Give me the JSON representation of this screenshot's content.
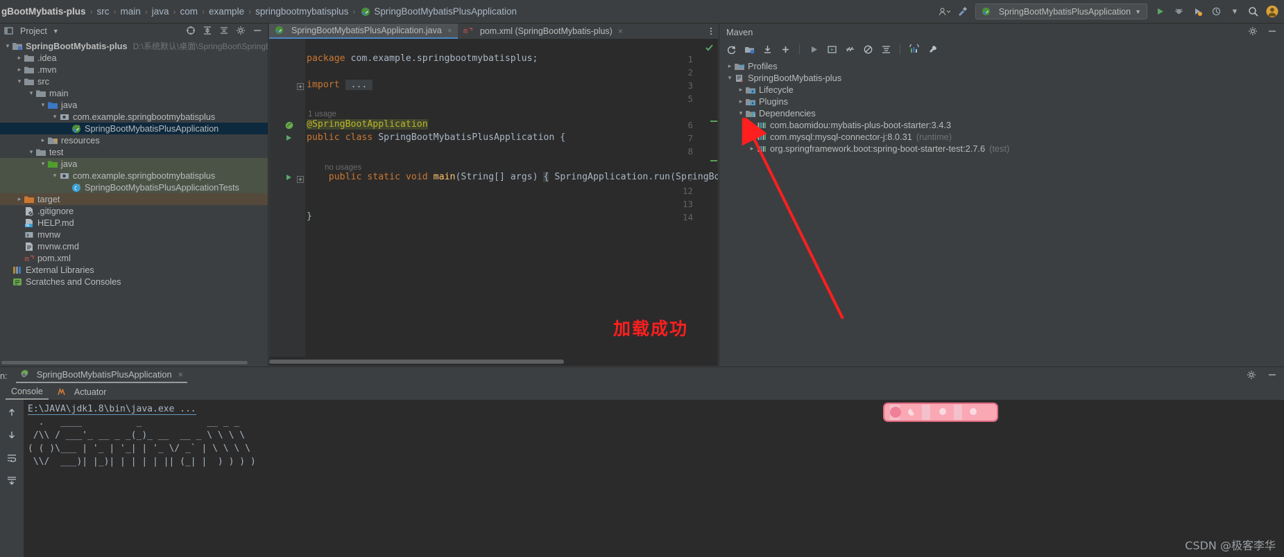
{
  "titlebar": {
    "breadcrumb": [
      "gBootMybatis-plus",
      "src",
      "main",
      "java",
      "com",
      "example",
      "springbootmybatisplus",
      "SpringBootMybatisPlusApplication"
    ],
    "breadcrumb_separator": "›",
    "run_config": "SpringBootMybatisPlusApplication",
    "icons": [
      "user-avatar-icon",
      "hammer-build-icon",
      "run-icon",
      "debug-icon",
      "coverage-icon",
      "profiler-icon",
      "more-icon",
      "search-icon",
      "settings-avatar-icon"
    ]
  },
  "project_panel": {
    "title": "Project",
    "header_icons": [
      "select-opened-file-icon",
      "expand-all-icon",
      "collapse-all-icon",
      "settings-icon",
      "hide-icon"
    ],
    "tree": [
      {
        "label": "SpringBootMybatis-plus",
        "hint": "D:\\系统默认\\桌面\\SpringBoot\\SpringBootMybatis",
        "depth": 0,
        "arrow": "open",
        "icon": "project-root-icon",
        "bold": true,
        "state": "normal"
      },
      {
        "label": ".idea",
        "hint": "",
        "depth": 1,
        "arrow": "closed",
        "icon": "folder-icon",
        "bold": false,
        "state": "normal"
      },
      {
        "label": ".mvn",
        "hint": "",
        "depth": 1,
        "arrow": "closed",
        "icon": "folder-icon",
        "bold": false,
        "state": "normal"
      },
      {
        "label": "src",
        "hint": "",
        "depth": 1,
        "arrow": "open",
        "icon": "folder-icon",
        "bold": false,
        "state": "normal"
      },
      {
        "label": "main",
        "hint": "",
        "depth": 2,
        "arrow": "open",
        "icon": "folder-icon",
        "bold": false,
        "state": "normal"
      },
      {
        "label": "java",
        "hint": "",
        "depth": 3,
        "arrow": "open",
        "icon": "source-root-icon",
        "bold": false,
        "state": "normal"
      },
      {
        "label": "com.example.springbootmybatisplus",
        "hint": "",
        "depth": 4,
        "arrow": "open",
        "icon": "package-icon",
        "bold": false,
        "state": "normal"
      },
      {
        "label": "SpringBootMybatisPlusApplication",
        "hint": "",
        "depth": 5,
        "arrow": "none",
        "icon": "spring-class-icon",
        "bold": false,
        "state": "selected"
      },
      {
        "label": "resources",
        "hint": "",
        "depth": 3,
        "arrow": "closed",
        "icon": "resource-root-icon",
        "bold": false,
        "state": "normal"
      },
      {
        "label": "test",
        "hint": "",
        "depth": 2,
        "arrow": "open",
        "icon": "folder-icon",
        "bold": false,
        "state": "normal"
      },
      {
        "label": "java",
        "hint": "",
        "depth": 3,
        "arrow": "open",
        "icon": "test-source-root-icon",
        "bold": false,
        "state": "green"
      },
      {
        "label": "com.example.springbootmybatisplus",
        "hint": "",
        "depth": 4,
        "arrow": "open",
        "icon": "package-icon",
        "bold": false,
        "state": "green"
      },
      {
        "label": "SpringBootMybatisPlusApplicationTests",
        "hint": "",
        "depth": 5,
        "arrow": "none",
        "icon": "test-class-icon",
        "bold": false,
        "state": "green"
      },
      {
        "label": "target",
        "hint": "",
        "depth": 1,
        "arrow": "closed",
        "icon": "excluded-folder-icon",
        "bold": false,
        "state": "brown"
      },
      {
        "label": ".gitignore",
        "hint": "",
        "depth": 1,
        "arrow": "none",
        "icon": "gitignore-file-icon",
        "bold": false,
        "state": "normal"
      },
      {
        "label": "HELP.md",
        "hint": "",
        "depth": 1,
        "arrow": "none",
        "icon": "markdown-file-icon",
        "bold": false,
        "state": "normal"
      },
      {
        "label": "mvnw",
        "hint": "",
        "depth": 1,
        "arrow": "none",
        "icon": "shell-file-icon",
        "bold": false,
        "state": "normal"
      },
      {
        "label": "mvnw.cmd",
        "hint": "",
        "depth": 1,
        "arrow": "none",
        "icon": "cmd-file-icon",
        "bold": false,
        "state": "normal"
      },
      {
        "label": "pom.xml",
        "hint": "",
        "depth": 1,
        "arrow": "none",
        "icon": "maven-file-icon",
        "bold": false,
        "state": "normal"
      },
      {
        "label": "External Libraries",
        "hint": "",
        "depth": 0,
        "arrow": "none",
        "icon": "library-icon",
        "bold": false,
        "state": "normal"
      },
      {
        "label": "Scratches and Consoles",
        "hint": "",
        "depth": 0,
        "arrow": "none",
        "icon": "scratches-icon",
        "bold": false,
        "state": "normal"
      }
    ]
  },
  "editor": {
    "tabs": [
      {
        "label": "SpringBootMybatisPlusApplication.java",
        "icon": "spring-class-icon",
        "active": true,
        "close": "×"
      },
      {
        "label": "pom.xml (SpringBootMybatis-plus)",
        "icon": "maven-file-icon",
        "active": false,
        "close": "×"
      }
    ],
    "more_icon": "more-vertical-icon",
    "inspection_status": "✓",
    "line_numbers": [
      "1",
      "2",
      "3",
      "5",
      "6",
      "7",
      "8",
      "9",
      "12",
      "13",
      "14"
    ],
    "code_lines": [
      {
        "n": "1",
        "segments": [
          {
            "t": "package",
            "c": "kw"
          },
          {
            "t": " com.example.springbootmybatisplus;",
            "c": "plain"
          }
        ]
      },
      {
        "n": "3",
        "segments": [
          {
            "t": "import",
            "c": "kw"
          },
          {
            "t": " ",
            "c": "plain"
          },
          {
            "t": "...",
            "c": "fold"
          }
        ]
      },
      {
        "n": "6",
        "segments": [
          {
            "t": "@SpringBootApplication",
            "c": "ann"
          }
        ]
      },
      {
        "n": "7",
        "segments": [
          {
            "t": "public",
            "c": "kw"
          },
          {
            "t": " ",
            "c": "plain"
          },
          {
            "t": "class",
            "c": "kw"
          },
          {
            "t": " SpringBootMybatisPlusApplication {",
            "c": "plain"
          }
        ]
      },
      {
        "n": "9",
        "segments": [
          {
            "t": "    ",
            "c": "plain"
          },
          {
            "t": "public",
            "c": "kw"
          },
          {
            "t": " ",
            "c": "plain"
          },
          {
            "t": "static",
            "c": "kw"
          },
          {
            "t": " ",
            "c": "plain"
          },
          {
            "t": "void",
            "c": "kw"
          },
          {
            "t": " ",
            "c": "plain"
          },
          {
            "t": "main",
            "c": "mth"
          },
          {
            "t": "(String[] args) ",
            "c": "plain"
          },
          {
            "t": "{",
            "c": "brkt"
          },
          {
            "t": " SpringApplication.run(SpringBootMybatisPlus",
            "c": "plain"
          }
        ]
      },
      {
        "n": "13",
        "segments": [
          {
            "t": "}",
            "c": "plain"
          }
        ]
      }
    ],
    "usage_hint_1": "1 usage",
    "usage_hint_2": "no usages",
    "gutter_icons": [
      "spring-bean-icon",
      "run-gutter-icon",
      "run-gutter-icon"
    ],
    "h_scrollbar": "horizontal-scrollbar"
  },
  "maven_panel": {
    "title": "Maven",
    "header_icons": [
      "settings-icon",
      "hide-icon"
    ],
    "toolbar_icons": [
      "reload-icon",
      "add-maven-project-icon",
      "download-sources-icon",
      "add-icon",
      "run-icon",
      "execute-goal-icon",
      "toggle-skip-tests-icon",
      "toggle-offline-icon",
      "collapse-all-icon",
      "show-dependencies-icon",
      "maven-settings-icon"
    ],
    "tree": [
      {
        "label": "Profiles",
        "depth": 0,
        "arrow": "closed",
        "icon": "profiles-icon",
        "scope": ""
      },
      {
        "label": "SpringBootMybatis-plus",
        "depth": 0,
        "arrow": "open",
        "icon": "maven-project-icon",
        "scope": ""
      },
      {
        "label": "Lifecycle",
        "depth": 1,
        "arrow": "closed",
        "icon": "lifecycle-icon",
        "scope": ""
      },
      {
        "label": "Plugins",
        "depth": 1,
        "arrow": "closed",
        "icon": "plugins-icon",
        "scope": ""
      },
      {
        "label": "Dependencies",
        "depth": 1,
        "arrow": "open",
        "icon": "dependencies-icon",
        "scope": ""
      },
      {
        "label": "com.baomidou:mybatis-plus-boot-starter:3.4.3",
        "depth": 2,
        "arrow": "closed",
        "icon": "dependency-icon",
        "scope": ""
      },
      {
        "label": "com.mysql:mysql-connector-j:8.0.31",
        "depth": 2,
        "arrow": "none",
        "icon": "dependency-icon",
        "scope": "(runtime)"
      },
      {
        "label": "org.springframework.boot:spring-boot-starter-test:2.7.6",
        "depth": 2,
        "arrow": "closed",
        "icon": "dependency-icon",
        "scope": "(test)"
      }
    ]
  },
  "run_panel": {
    "label": "n:",
    "tab_label": "SpringBootMybatisPlusApplication",
    "tab_icon": "spring-run-icon",
    "tab_close": "×",
    "subtabs": [
      {
        "label": "Console",
        "icon": "",
        "active": true
      },
      {
        "label": "Actuator",
        "icon": "actuator-icon",
        "active": false
      }
    ],
    "header_icons": [
      "settings-icon",
      "hide-icon"
    ],
    "side_icons": [
      "scroll-up-icon",
      "scroll-down-icon",
      "soft-wrap-icon",
      "scroll-to-end-icon"
    ],
    "console_command": "E:\\JAVA\\jdk1.8\\bin\\java.exe ...",
    "console_banner": [
      "  .   ____          _            __ _ _",
      " /\\\\ / ___'_ __ _ _(_)_ __  __ _ \\ \\ \\ \\",
      "( ( )\\___ | '_ | '_| | '_ \\/ _` | \\ \\ \\ \\",
      " \\\\/  ___)| |_)| | | | | || (_| |  ) ) ) )"
    ]
  },
  "annotation": {
    "text": "加载成功",
    "color": "#ff1f1f",
    "arrow_name": "red-arrow-annotation"
  },
  "watermark": "CSDN @极客李华"
}
